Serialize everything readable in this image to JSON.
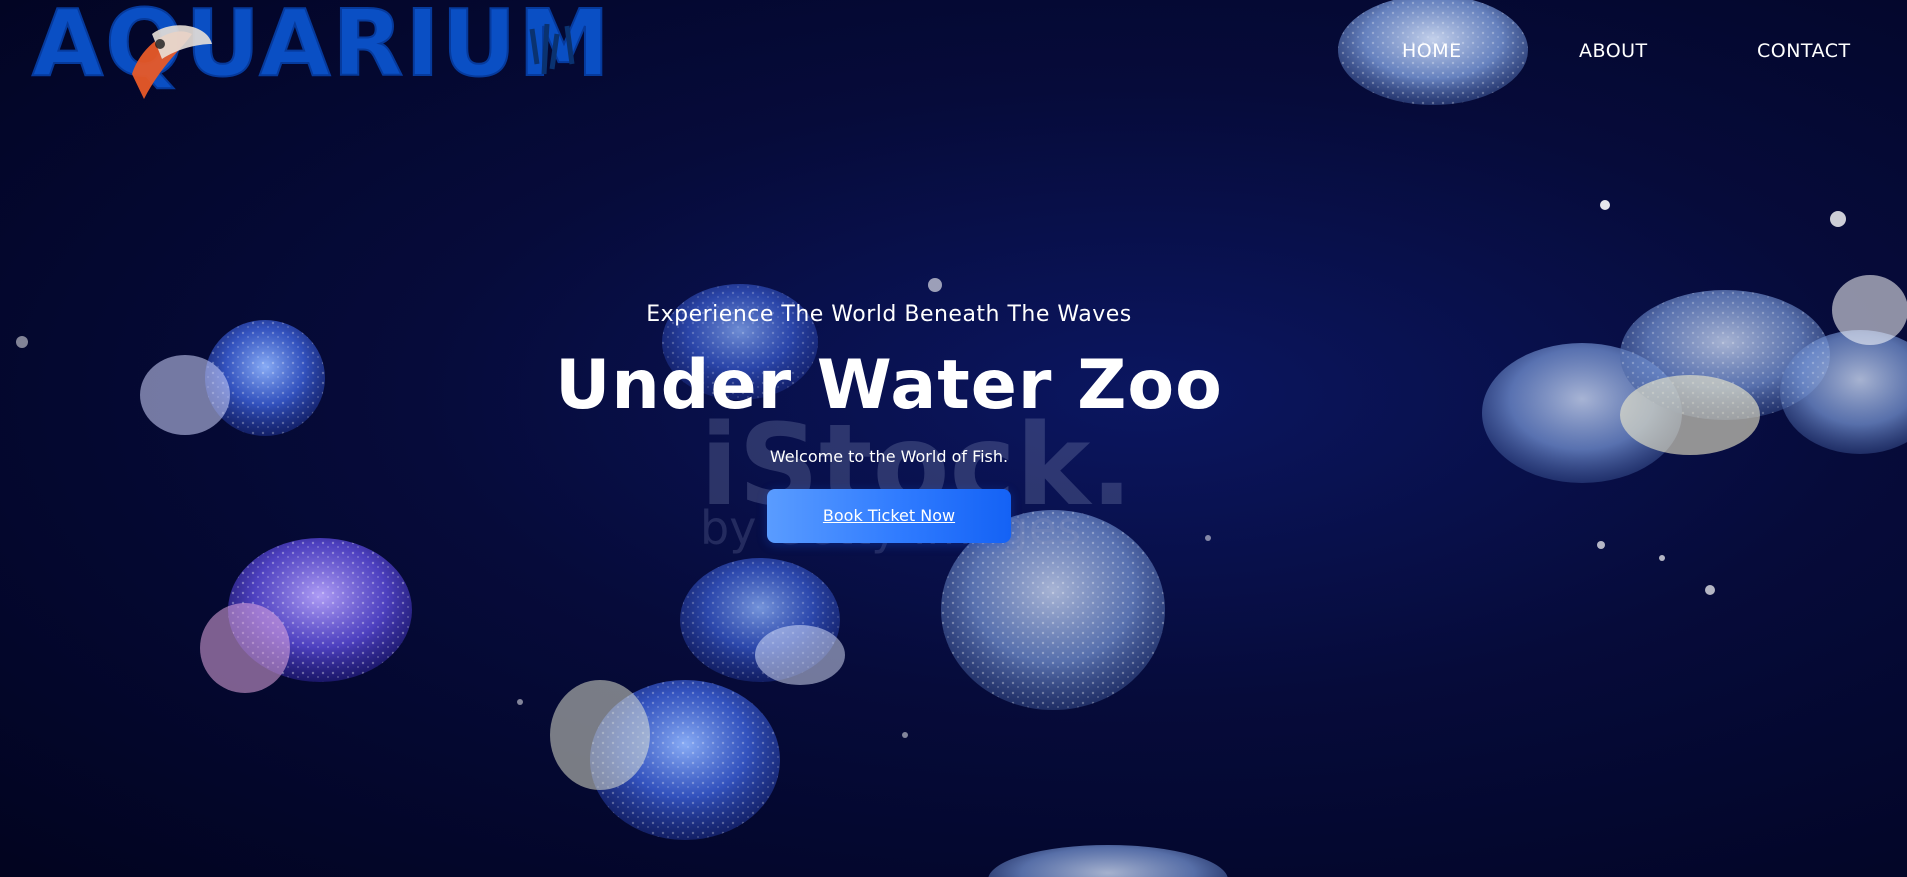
{
  "brand": {
    "logo_text": "AQUARIUM",
    "logo_color": "#0a4fc4"
  },
  "nav": {
    "items": [
      {
        "label": "HOME"
      },
      {
        "label": "ABOUT"
      },
      {
        "label": "CONTACT"
      }
    ]
  },
  "hero": {
    "kicker": "Experience The World Beneath The Waves",
    "title": "Under Water Zoo",
    "subtitle": "Welcome to the World of Fish.",
    "cta_label": "Book Ticket Now",
    "background": "jellyfish-aquarium-photo"
  },
  "watermark": {
    "main": "iStock.",
    "sub": "by Getty Images"
  },
  "colors": {
    "background_dark": "#03062a",
    "accent_blue": "#2f7bff",
    "text": "#ffffff"
  }
}
